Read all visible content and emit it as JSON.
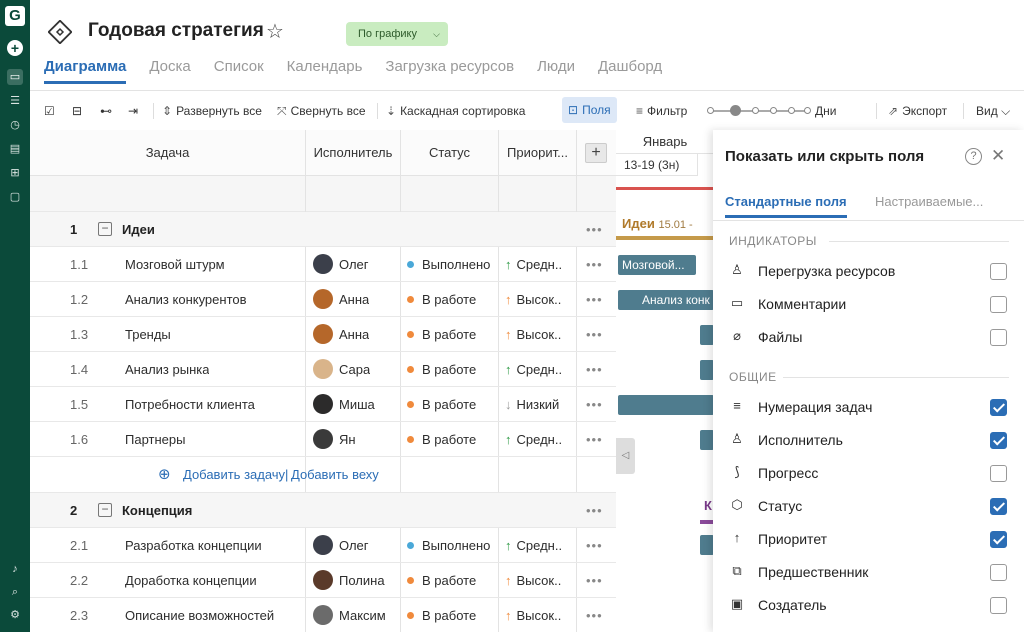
{
  "rail": {
    "logo": "G"
  },
  "header": {
    "title": "Годовая стратегия",
    "status": "По графику",
    "tabs": [
      "Диаграмма",
      "Доска",
      "Список",
      "Календарь",
      "Загрузка ресурсов",
      "Люди",
      "Дашборд"
    ]
  },
  "toolbar": {
    "expand": "Развернуть все",
    "collapse": "Свернуть все",
    "cascade": "Каскадная сортировка",
    "fields": "Поля",
    "filter": "Фильтр",
    "zoom": "Дни",
    "export": "Экспорт",
    "view": "Вид"
  },
  "grid": {
    "columns": [
      "Задача",
      "Исполнитель",
      "Статус",
      "Приорит..."
    ],
    "groups": [
      {
        "num": "1",
        "name": "Идеи",
        "rows": [
          {
            "num": "1.1",
            "task": "Мозговой штурм",
            "assignee": "Олег",
            "status": "Выполнено",
            "status_color": "#4aa8d8",
            "priority": "Средн..",
            "prio_arrow": "↑",
            "prio_color": "#2e9a45"
          },
          {
            "num": "1.2",
            "task": "Анализ конкурентов",
            "assignee": "Анна",
            "status": "В работе",
            "status_color": "#f08a3c",
            "priority": "Высок..",
            "prio_arrow": "↑",
            "prio_color": "#f08a3c"
          },
          {
            "num": "1.3",
            "task": "Тренды",
            "assignee": "Анна",
            "status": "В работе",
            "status_color": "#f08a3c",
            "priority": "Высок..",
            "prio_arrow": "↑",
            "prio_color": "#f08a3c"
          },
          {
            "num": "1.4",
            "task": "Анализ рынка",
            "assignee": "Сара",
            "status": "В работе",
            "status_color": "#f08a3c",
            "priority": "Средн..",
            "prio_arrow": "↑",
            "prio_color": "#2e9a45"
          },
          {
            "num": "1.5",
            "task": "Потребности клиента",
            "assignee": "Миша",
            "status": "В работе",
            "status_color": "#f08a3c",
            "priority": "Низкий",
            "prio_arrow": "↓",
            "prio_color": "#999999"
          },
          {
            "num": "1.6",
            "task": "Партнеры",
            "assignee": "Ян",
            "status": "В работе",
            "status_color": "#f08a3c",
            "priority": "Средн..",
            "prio_arrow": "↑",
            "prio_color": "#2e9a45"
          }
        ]
      },
      {
        "num": "2",
        "name": "Концепция",
        "rows": [
          {
            "num": "2.1",
            "task": "Разработка концепции",
            "assignee": "Олег",
            "status": "Выполнено",
            "status_color": "#4aa8d8",
            "priority": "Средн..",
            "prio_arrow": "↑",
            "prio_color": "#2e9a45"
          },
          {
            "num": "2.2",
            "task": "Доработка концепции",
            "assignee": "Полина",
            "status": "В работе",
            "status_color": "#f08a3c",
            "priority": "Высок..",
            "prio_arrow": "↑",
            "prio_color": "#f08a3c"
          },
          {
            "num": "2.3",
            "task": "Описание возможностей",
            "assignee": "Максим",
            "status": "В работе",
            "status_color": "#f08a3c",
            "priority": "Высок..",
            "prio_arrow": "↑",
            "prio_color": "#f08a3c"
          }
        ]
      }
    ],
    "add_task": "Добавить задачу",
    "add_milestone": "Добавить веху"
  },
  "gantt": {
    "month": "Январь",
    "week": "13-19 (3н)",
    "group_label": "Идеи",
    "group_date": "15.01 -",
    "bar1": "Мозговой...",
    "bar2": "Анализ конк",
    "group2_label": "К"
  },
  "panel": {
    "title": "Показать или скрыть поля",
    "tab_standard": "Стандартные поля",
    "tab_custom": "Настраиваемые...",
    "section_indicators": "ИНДИКАТОРЫ",
    "section_general": "ОБЩИЕ",
    "indicators": [
      {
        "label": "Перегрузка ресурсов",
        "icon": "person-alert-icon",
        "checked": false
      },
      {
        "label": "Комментарии",
        "icon": "comment-icon",
        "checked": false
      },
      {
        "label": "Файлы",
        "icon": "paperclip-icon",
        "checked": false
      }
    ],
    "general": [
      {
        "label": "Нумерация задач",
        "icon": "list-numbers-icon",
        "checked": true
      },
      {
        "label": "Исполнитель",
        "icon": "person-icon",
        "checked": true
      },
      {
        "label": "Прогресс",
        "icon": "progress-icon",
        "checked": false
      },
      {
        "label": "Статус",
        "icon": "status-icon",
        "checked": true
      },
      {
        "label": "Приоритет",
        "icon": "arrow-up-icon",
        "checked": true
      },
      {
        "label": "Предшественник",
        "icon": "predecessor-icon",
        "checked": false
      },
      {
        "label": "Создатель",
        "icon": "creator-icon",
        "checked": false
      }
    ]
  }
}
